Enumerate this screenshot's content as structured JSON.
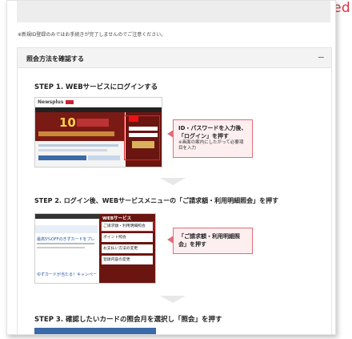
{
  "badge": "opened",
  "notice": "※新規ID登録のみではお手続きが完了しませんのでご注意ください。",
  "accordion": {
    "title": "照会方法を確認する",
    "toggle": "−"
  },
  "step1": {
    "title": "STEP 1.  WEBサービスにログインする",
    "logo": "Newsplus",
    "banner": "10",
    "callout_main": "ID・パスワードを入力後、「ログイン」を押す",
    "callout_sub": "※画面の案内にしたがって必要項目を入力"
  },
  "step2": {
    "title": "STEP 2.  ログイン後、WEBサービスメニューの「ご請求額・利用明細照会」を押す",
    "menu_header": "WEBサービス",
    "menu_items": [
      "ご請求額・利用明細照会",
      "ポイント照会",
      "お支払い方法の変更",
      "登録内容の変更"
    ],
    "left_link1": "最高5%OFFのきずカードをプレ",
    "left_link2": "ゆずカードが当たる！キャンペー",
    "callout_main": "「ご請求額・利用明細照会」を押す"
  },
  "step3": {
    "title": "STEP 3.  確認したいカードの照会月を選択し「照会」を押す"
  },
  "colors": {
    "accent": "#e0303a",
    "callout_bg": "#fdeff0"
  }
}
